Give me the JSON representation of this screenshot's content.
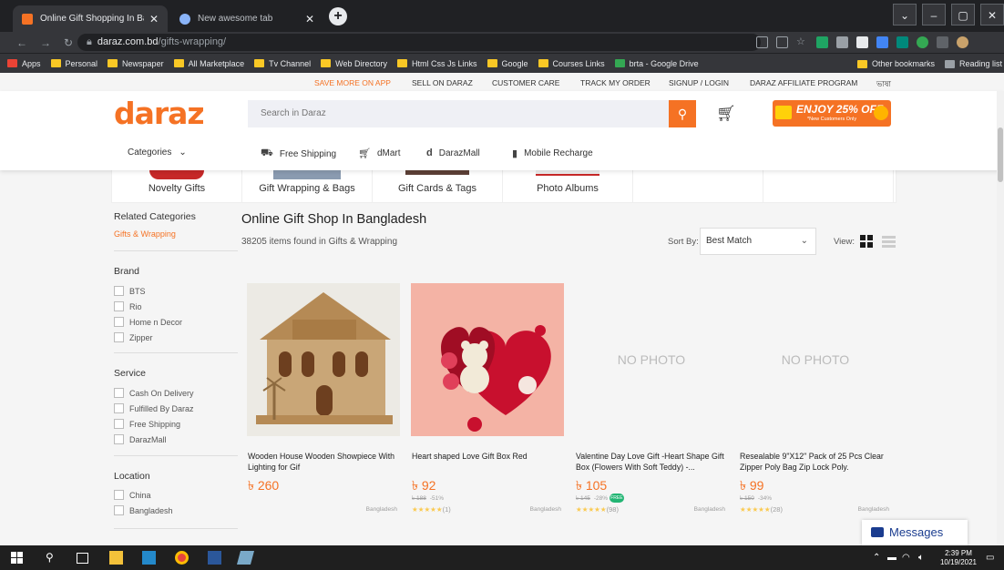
{
  "browser": {
    "active_tab": "Online Gift Shopping In Bangladesh",
    "inactive_tab": "New awesome tab",
    "url_domain": "daraz.com.bd",
    "url_path": "/gifts-wrapping/",
    "bookmarks": [
      "Apps",
      "Personal",
      "Newspaper",
      "All Marketplace",
      "Tv Channel",
      "Web Directory",
      "Html Css Js Links",
      "Google",
      "Courses Links",
      "brta - Google Drive"
    ],
    "other_bookmarks": "Other bookmarks",
    "reading_list": "Reading list"
  },
  "topbar": {
    "save_more": "SAVE MORE ON APP",
    "sell": "SELL ON DARAZ",
    "care": "CUSTOMER CARE",
    "track": "TRACK MY ORDER",
    "signup": "SIGNUP / LOGIN",
    "affiliate": "DARAZ AFFILIATE PROGRAM",
    "language": "ভাষা"
  },
  "header": {
    "logo": "daraz",
    "search_placeholder": "Search in Daraz",
    "promo_big": "ENJOY 25% OFF",
    "promo_small": "*New Customers Only",
    "categories": "Categories",
    "nav": [
      "Free Shipping",
      "dMart",
      "DarazMall",
      "Mobile Recharge"
    ]
  },
  "tiles": [
    "Novelty Gifts",
    "Gift Wrapping & Bags",
    "Gift Cards & Tags",
    "Photo Albums"
  ],
  "sidebar": {
    "related_title": "Related Categories",
    "related_item": "Gifts & Wrapping",
    "brand_title": "Brand",
    "brands": [
      "BTS",
      "Rio",
      "Home n Decor",
      "Zipper"
    ],
    "service_title": "Service",
    "services": [
      "Cash On Delivery",
      "Fulfilled By Daraz",
      "Free Shipping",
      "DarazMall"
    ],
    "location_title": "Location",
    "locations": [
      "China",
      "Bangladesh"
    ]
  },
  "main": {
    "title": "Online Gift Shop In Bangladesh",
    "count": "38205 items found in Gifts & Wrapping",
    "sort_label": "Sort By:",
    "sort_value": "Best Match",
    "view_label": "View:"
  },
  "products": [
    {
      "name": "Wooden House Wooden Showpiece With Lighting for Gif",
      "price": "৳ 260",
      "old": "",
      "discount": "",
      "stars": "",
      "reviews": "",
      "location": "Bangladesh",
      "photo": "house"
    },
    {
      "name": "Heart shaped Love Gift Box Red",
      "price": "৳ 92",
      "old": "৳ 188",
      "discount": "-51%",
      "stars": "★★★★★",
      "reviews": "(1)",
      "location": "Bangladesh",
      "photo": "heart"
    },
    {
      "name": "Valentine Day Love Gift -Heart Shape Gift Box (Flowers With Soft Teddy) -...",
      "price": "৳ 105",
      "old": "৳ 145",
      "discount": "-28%",
      "stars": "★★★★★",
      "reviews": "(98)",
      "location": "Bangladesh",
      "photo": "none",
      "free": "FREE"
    },
    {
      "name": "Resealable 9\"X12\" Pack of 25 Pcs Clear Zipper Poly Bag Zip Lock Poly.",
      "price": "৳ 99",
      "old": "৳ 150",
      "discount": "-34%",
      "stars": "★★★★★",
      "reviews": "(28)",
      "location": "Bangladesh",
      "photo": "none"
    }
  ],
  "no_photo": "NO PHOTO",
  "messages": "Messages",
  "taskbar": {
    "time": "2:39 PM",
    "date": "10/19/2021"
  },
  "colors": {
    "accent": "#f57224",
    "chrome_dark": "#202124",
    "chrome_mid": "#35363a"
  }
}
